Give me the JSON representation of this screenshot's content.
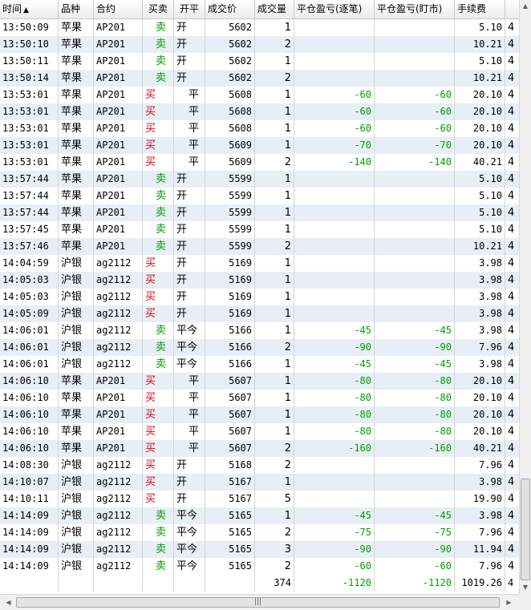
{
  "columns": [
    "时间",
    "品种",
    "合约",
    "买卖",
    "开平",
    "成交价",
    "成交量",
    "平仓盈亏(逐笔)",
    "平仓盈亏(盯市)",
    "手续费",
    ""
  ],
  "sort_indicator": "▲",
  "rows": [
    [
      "13:50:09",
      "苹果",
      "AP201",
      "卖",
      "开",
      "5602",
      "1",
      "",
      "",
      "5.10",
      "4"
    ],
    [
      "13:50:10",
      "苹果",
      "AP201",
      "卖",
      "开",
      "5602",
      "2",
      "",
      "",
      "10.21",
      "4"
    ],
    [
      "13:50:11",
      "苹果",
      "AP201",
      "卖",
      "开",
      "5602",
      "1",
      "",
      "",
      "5.10",
      "4"
    ],
    [
      "13:50:14",
      "苹果",
      "AP201",
      "卖",
      "开",
      "5602",
      "2",
      "",
      "",
      "10.21",
      "4"
    ],
    [
      "13:53:01",
      "苹果",
      "AP201",
      "买",
      "平",
      "5608",
      "1",
      "-60",
      "-60",
      "20.10",
      "4"
    ],
    [
      "13:53:01",
      "苹果",
      "AP201",
      "买",
      "平",
      "5608",
      "1",
      "-60",
      "-60",
      "20.10",
      "4"
    ],
    [
      "13:53:01",
      "苹果",
      "AP201",
      "买",
      "平",
      "5608",
      "1",
      "-60",
      "-60",
      "20.10",
      "4"
    ],
    [
      "13:53:01",
      "苹果",
      "AP201",
      "买",
      "平",
      "5609",
      "1",
      "-70",
      "-70",
      "20.10",
      "4"
    ],
    [
      "13:53:01",
      "苹果",
      "AP201",
      "买",
      "平",
      "5609",
      "2",
      "-140",
      "-140",
      "40.21",
      "4"
    ],
    [
      "13:57:44",
      "苹果",
      "AP201",
      "卖",
      "开",
      "5599",
      "1",
      "",
      "",
      "5.10",
      "4"
    ],
    [
      "13:57:44",
      "苹果",
      "AP201",
      "卖",
      "开",
      "5599",
      "1",
      "",
      "",
      "5.10",
      "4"
    ],
    [
      "13:57:44",
      "苹果",
      "AP201",
      "卖",
      "开",
      "5599",
      "1",
      "",
      "",
      "5.10",
      "4"
    ],
    [
      "13:57:45",
      "苹果",
      "AP201",
      "卖",
      "开",
      "5599",
      "1",
      "",
      "",
      "5.10",
      "4"
    ],
    [
      "13:57:46",
      "苹果",
      "AP201",
      "卖",
      "开",
      "5599",
      "2",
      "",
      "",
      "10.21",
      "4"
    ],
    [
      "14:04:59",
      "沪银",
      "ag2112",
      "买",
      "开",
      "5169",
      "1",
      "",
      "",
      "3.98",
      "4"
    ],
    [
      "14:05:03",
      "沪银",
      "ag2112",
      "买",
      "开",
      "5169",
      "1",
      "",
      "",
      "3.98",
      "4"
    ],
    [
      "14:05:03",
      "沪银",
      "ag2112",
      "买",
      "开",
      "5169",
      "1",
      "",
      "",
      "3.98",
      "4"
    ],
    [
      "14:05:09",
      "沪银",
      "ag2112",
      "买",
      "开",
      "5169",
      "1",
      "",
      "",
      "3.98",
      "4"
    ],
    [
      "14:06:01",
      "沪银",
      "ag2112",
      "卖",
      "平今",
      "5166",
      "1",
      "-45",
      "-45",
      "3.98",
      "4"
    ],
    [
      "14:06:01",
      "沪银",
      "ag2112",
      "卖",
      "平今",
      "5166",
      "2",
      "-90",
      "-90",
      "7.96",
      "4"
    ],
    [
      "14:06:01",
      "沪银",
      "ag2112",
      "卖",
      "平今",
      "5166",
      "1",
      "-45",
      "-45",
      "3.98",
      "4"
    ],
    [
      "14:06:10",
      "苹果",
      "AP201",
      "买",
      "平",
      "5607",
      "1",
      "-80",
      "-80",
      "20.10",
      "4"
    ],
    [
      "14:06:10",
      "苹果",
      "AP201",
      "买",
      "平",
      "5607",
      "1",
      "-80",
      "-80",
      "20.10",
      "4"
    ],
    [
      "14:06:10",
      "苹果",
      "AP201",
      "买",
      "平",
      "5607",
      "1",
      "-80",
      "-80",
      "20.10",
      "4"
    ],
    [
      "14:06:10",
      "苹果",
      "AP201",
      "买",
      "平",
      "5607",
      "1",
      "-80",
      "-80",
      "20.10",
      "4"
    ],
    [
      "14:06:10",
      "苹果",
      "AP201",
      "买",
      "平",
      "5607",
      "2",
      "-160",
      "-160",
      "40.21",
      "4"
    ],
    [
      "14:08:30",
      "沪银",
      "ag2112",
      "买",
      "开",
      "5168",
      "2",
      "",
      "",
      "7.96",
      "4"
    ],
    [
      "14:10:07",
      "沪银",
      "ag2112",
      "买",
      "开",
      "5167",
      "1",
      "",
      "",
      "3.98",
      "4"
    ],
    [
      "14:10:11",
      "沪银",
      "ag2112",
      "买",
      "开",
      "5167",
      "5",
      "",
      "",
      "19.90",
      "4"
    ],
    [
      "14:14:09",
      "沪银",
      "ag2112",
      "卖",
      "平今",
      "5165",
      "1",
      "-45",
      "-45",
      "3.98",
      "4"
    ],
    [
      "14:14:09",
      "沪银",
      "ag2112",
      "卖",
      "平今",
      "5165",
      "2",
      "-75",
      "-75",
      "7.96",
      "4"
    ],
    [
      "14:14:09",
      "沪银",
      "ag2112",
      "卖",
      "平今",
      "5165",
      "3",
      "-90",
      "-90",
      "11.94",
      "4"
    ],
    [
      "14:14:09",
      "沪银",
      "ag2112",
      "卖",
      "平今",
      "5165",
      "2",
      "-60",
      "-60",
      "7.96",
      "4"
    ]
  ],
  "totals": [
    "",
    "",
    "",
    "",
    "",
    "",
    "374",
    "-1120",
    "-1120",
    "1019.26",
    "4"
  ],
  "colors": {
    "buy": "#e00000",
    "sell": "#00a000",
    "alt_row": "#e8eef6"
  },
  "scrollbar": {
    "up_arrow": "▲",
    "down_arrow": "▼",
    "left_arrow": "◀",
    "right_arrow": "▶",
    "grip": "|||",
    "vertical_position": 1.0,
    "horizontal_position": 0.0
  }
}
